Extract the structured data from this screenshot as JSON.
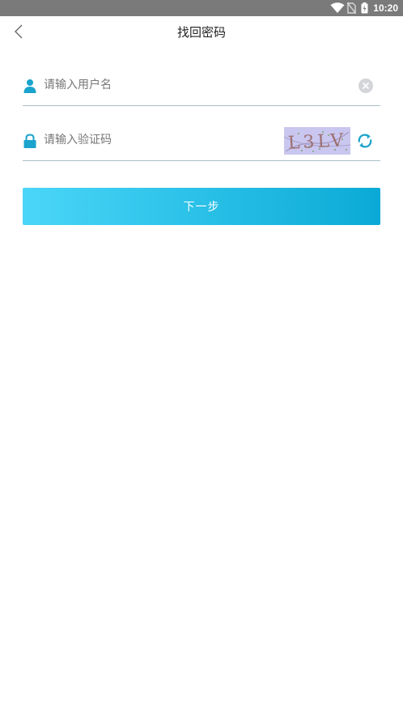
{
  "status_bar": {
    "time": "10:20"
  },
  "header": {
    "title": "找回密码"
  },
  "form": {
    "username": {
      "placeholder": "请输入用户名",
      "value": ""
    },
    "code": {
      "placeholder": "请输入验证码",
      "value": "",
      "captcha_text": "L3LV"
    },
    "next_label": "下一步"
  },
  "icons": {
    "back": "chevron-left-icon",
    "user": "user-icon",
    "lock": "lock-icon",
    "clear": "clear-circle-icon",
    "refresh": "refresh-icon"
  },
  "colors": {
    "accent": "#0aaad6",
    "accent_light": "#4ad6f8",
    "icon_blue": "#1aa3cc",
    "divider": "#a9bfc8",
    "captcha_bg": "#c9c6ef"
  }
}
